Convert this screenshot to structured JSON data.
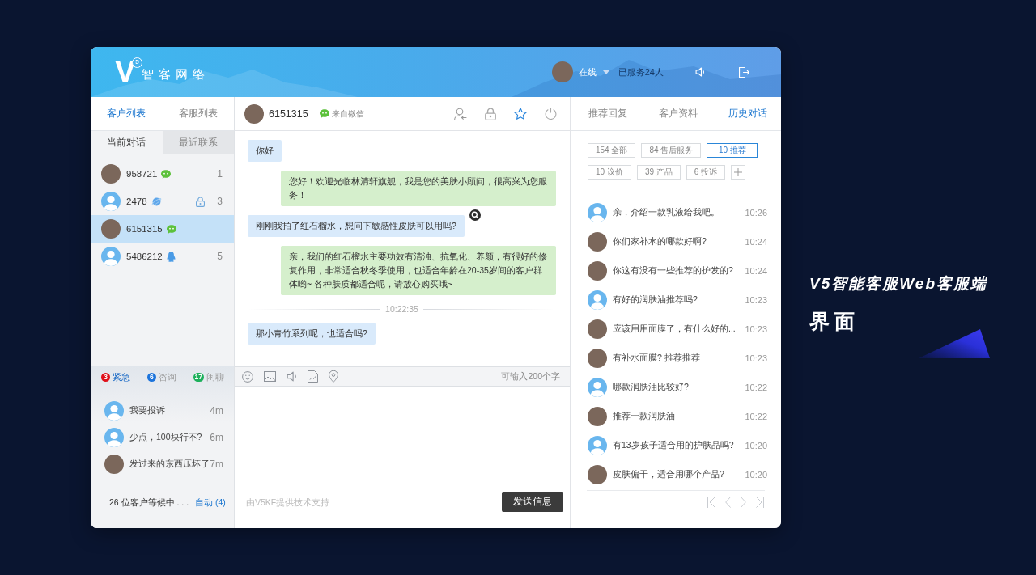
{
  "header": {
    "logo_mark": "V",
    "logo_badge": "5",
    "brand": "智客网络",
    "status": "在线",
    "served": "已服务24人"
  },
  "left_panel": {
    "tabs": [
      {
        "label": "客户列表",
        "selected": true
      },
      {
        "label": "客服列表",
        "selected": false
      }
    ],
    "subtabs": [
      {
        "label": "当前对话",
        "selected": true
      },
      {
        "label": "最近联系",
        "selected": false
      }
    ],
    "customers": [
      {
        "name": "958721",
        "photo": true,
        "kind": "wechat",
        "locked": false,
        "count": "1",
        "selected": false
      },
      {
        "name": "2478",
        "photo": false,
        "kind": "web",
        "locked": true,
        "count": "3",
        "selected": false
      },
      {
        "name": "6151315",
        "photo": true,
        "kind": "wechat",
        "locked": false,
        "selected": true
      },
      {
        "name": "5486212",
        "photo": false,
        "kind": "qq",
        "locked": false,
        "count": "5",
        "selected": false
      }
    ]
  },
  "queue": {
    "categories": [
      {
        "count": "3",
        "label": "紧急",
        "color": "#e0101a",
        "selected": true
      },
      {
        "count": "6",
        "label": "咨询",
        "color": "#1c74dc",
        "selected": false
      },
      {
        "count": "17",
        "label": "闲聊",
        "color": "#1db05b",
        "selected": false
      }
    ],
    "items": [
      {
        "photo": false,
        "text": "我要投诉",
        "wait": "4m"
      },
      {
        "photo": false,
        "text": "少点，100块行不?",
        "wait": "6m"
      },
      {
        "photo": true,
        "text": "发过来的东西压坏了",
        "wait": "7m"
      }
    ],
    "waiting": "26 位客户等候中 . . .",
    "auto_link": "自动 (4)"
  },
  "chat": {
    "name": "6151315",
    "photo": true,
    "kind": "wechat",
    "source_label": "来自微信",
    "starred": true,
    "messages": [
      {
        "kind": "customer",
        "text": "你好",
        "hovered": false
      },
      {
        "kind": "agent",
        "text": "您好！欢迎光临林清轩旗舰，我是您的美肤小顾问，很高兴为您服务！",
        "hovered": false
      },
      {
        "kind": "customer",
        "text": "刚刚我拍了红石榴水，想问下敏感性皮肤可以用吗?",
        "hovered": true
      },
      {
        "kind": "agent",
        "text": "亲，我们的红石榴水主要功效有清浊、抗氧化、养颜，有很好的修复作用，非常适合秋冬季使用，也适合年龄在20-35岁间的客户群体哟~ 各种肤质都适合呢，请放心购买哦~",
        "hovered": false
      },
      {
        "kind": "time",
        "text": "10:22:35"
      },
      {
        "kind": "customer",
        "text": "那小青竹系列呢，也适合吗?",
        "hovered": false
      }
    ],
    "limit": "可输入200个字",
    "credit": "由V5KF提供技术支持",
    "send": "发送信息"
  },
  "side_panel": {
    "tabs": [
      {
        "label": "推荐回复",
        "selected": false
      },
      {
        "label": "客户资料",
        "selected": false
      },
      {
        "label": "历史对话",
        "selected": true
      }
    ],
    "filters": [
      {
        "label": "154 全部",
        "selected": false
      },
      {
        "label": "84 售后服务",
        "selected": false
      },
      {
        "label": "10 推荐",
        "selected": true
      },
      {
        "label": "10 议价",
        "selected": false
      },
      {
        "label": "39 产品",
        "selected": false
      },
      {
        "label": "6 投诉",
        "selected": false
      }
    ],
    "history": [
      {
        "photo": false,
        "text": "亲，介绍一款乳液给我吧。",
        "time": "10:26"
      },
      {
        "photo": true,
        "text": "你们家补水的哪款好啊?",
        "time": "10:24"
      },
      {
        "photo": true,
        "text": "你这有没有一些推荐的护发的?",
        "time": "10:24"
      },
      {
        "photo": false,
        "text": "有好的润肤油推荐吗?",
        "time": "10:23"
      },
      {
        "photo": true,
        "text": "应该用用面膜了，有什么好的...",
        "time": "10:23"
      },
      {
        "photo": true,
        "text": "有补水面膜? 推荐推荐",
        "time": "10:23"
      },
      {
        "photo": false,
        "text": "哪款润肤油比较好?",
        "time": "10:22"
      },
      {
        "photo": true,
        "text": "推荐一款润肤油",
        "time": "10:22"
      },
      {
        "photo": false,
        "text": "有13岁孩子适合用的护肤品吗?",
        "time": "10:20"
      },
      {
        "photo": true,
        "text": "皮肤偏干，适合用哪个产品?",
        "time": "10:20"
      }
    ]
  },
  "promo": {
    "title": "V5智能客服Web客服端",
    "subtitle": "界面"
  }
}
